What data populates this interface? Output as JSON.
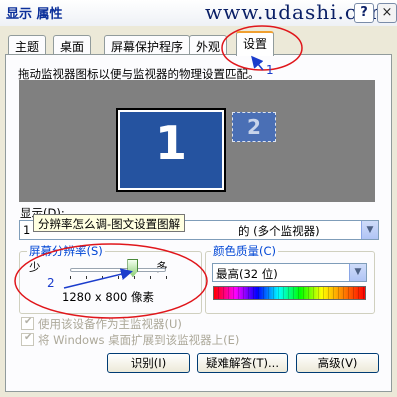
{
  "window": {
    "title": "显示 属性",
    "watermark": "www.udashi.com",
    "help_label": "?",
    "close_label": "×"
  },
  "tabs": [
    {
      "label": "主题",
      "active": false
    },
    {
      "label": "桌面",
      "active": false
    },
    {
      "label": "屏幕保护程序",
      "active": false
    },
    {
      "label": "外观",
      "active": false
    },
    {
      "label": "设置",
      "active": true
    }
  ],
  "settings": {
    "instruction": "拖动监视器图标以便与监视器的物理设置匹配。",
    "monitors": [
      {
        "number": "1",
        "active": true
      },
      {
        "number": "2",
        "active": false
      }
    ],
    "display_label": "显示(D):",
    "display_value": "1",
    "display_value_suffix": "的 (多个监视器)",
    "tooltip": "分辨率怎么调-图文设置图解",
    "resolution": {
      "title": "屏幕分辨率(S)",
      "less_label": "少",
      "more_label": "多",
      "value_text": "1280 x 800 像素",
      "slider_position": 0.65
    },
    "color_quality": {
      "title": "颜色质量(C)",
      "value": "最高(32 位)"
    },
    "checkboxes": [
      {
        "label": "使用该设备作为主监视器(U)",
        "checked": true,
        "enabled": false
      },
      {
        "label": "将 Windows 桌面扩展到该监视器上(E)",
        "checked": true,
        "enabled": false
      }
    ],
    "buttons": {
      "identify": "识别(I)",
      "troubleshoot": "疑难解答(T)...",
      "advanced": "高级(V)"
    }
  },
  "annotations": {
    "label_1": "1",
    "label_2": "2",
    "color": "#e0161b",
    "arrow_color": "#1a3ccc"
  }
}
